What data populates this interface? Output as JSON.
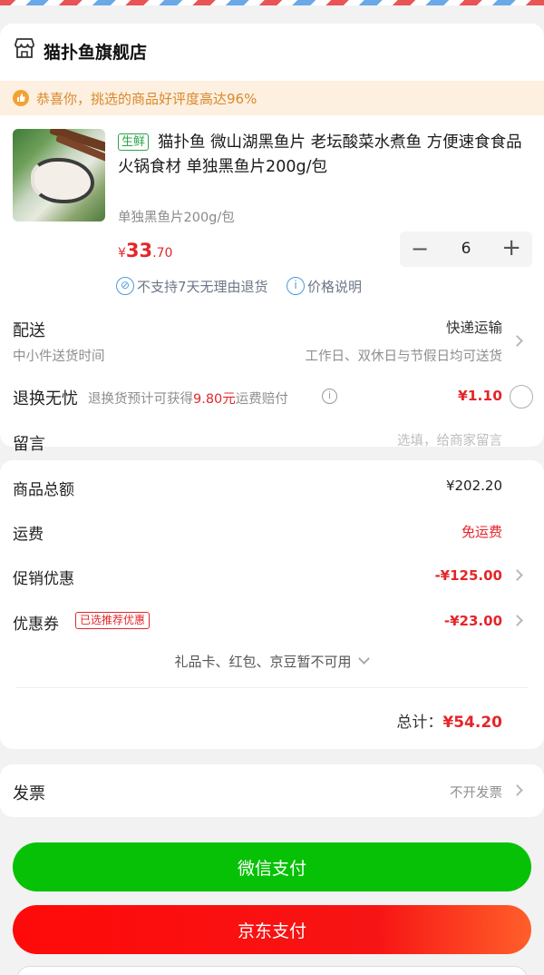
{
  "shop": {
    "name": "猫扑鱼旗舰店",
    "icon": "store-icon"
  },
  "tip": {
    "text": "恭喜你，挑选的商品好评度高达96%",
    "icon": "thumbs-up-icon",
    "color": "#f3a235"
  },
  "product": {
    "tag": "生鲜",
    "title": "猫扑鱼 微山湖黑鱼片 老坛酸菜水煮鱼 方便速食食品 火锅食材 单独黑鱼片200g/包",
    "spec": "单独黑鱼片200g/包",
    "price_symbol": "¥",
    "price_int": "33",
    "price_dec": ".70",
    "quantity": "6",
    "minus": "−",
    "plus": "+",
    "services": [
      {
        "icon": "no-return-icon",
        "glyph": "⊘",
        "text": "不支持7天无理由退货"
      },
      {
        "icon": "info-icon",
        "glyph": "i",
        "text": "价格说明"
      }
    ]
  },
  "shipping": {
    "label": "配送",
    "method": "快递运输",
    "time_label": "中小件送货时间",
    "time_value": "工作日、双休日与节假日均可送货"
  },
  "exchange": {
    "label": "退换无忧",
    "desc_prefix": "退换货预计可获得",
    "desc_highlight": "9.80元",
    "desc_suffix": "运费赔付",
    "price": "¥1.10"
  },
  "message": {
    "label": "留言",
    "placeholder": "选填，给商家留言"
  },
  "pricing": {
    "goods_label": "商品总额",
    "goods_value": "¥202.20",
    "freight_label": "运费",
    "freight_value": "免运费",
    "promo_label": "促销优惠",
    "promo_value": "-¥125.00",
    "coupon_label": "优惠券",
    "coupon_badge": "已选推荐优惠",
    "coupon_value": "-¥23.00",
    "unavailable": "礼品卡、红包、京豆暂不可用",
    "total_label": "总计：",
    "total_value": "¥54.20"
  },
  "invoice": {
    "label": "发票",
    "value": "不开发票"
  },
  "buttons": {
    "wechat": "微信支付",
    "jd": "京东支付"
  },
  "colors": {
    "accent_red": "#e4262b",
    "wechat_green": "#07c107",
    "fresh_green": "#2aa34b"
  }
}
